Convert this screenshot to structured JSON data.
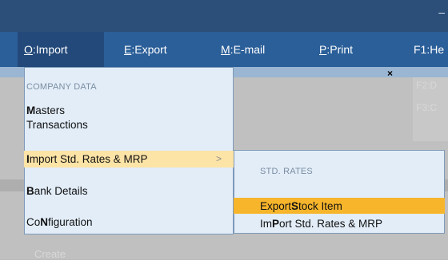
{
  "titlebar": {
    "dash": "–"
  },
  "menubar": {
    "import": {
      "key": "O",
      "sep": ":",
      "label": "Import"
    },
    "export": {
      "key": "E",
      "sep": ":",
      "label": "Export"
    },
    "email": {
      "key": "M",
      "sep": ":",
      "label": "E-mail"
    },
    "print": {
      "key": "P",
      "sep": ":",
      "label": "Print"
    },
    "help": {
      "key": "F1",
      "sep": ":",
      "label": "He"
    }
  },
  "background": {
    "right_items": [
      "F2:D",
      "F3:C"
    ],
    "create": "Create"
  },
  "close_icon": "×",
  "dropdown": {
    "section": "COMPANY DATA",
    "items": {
      "masters": {
        "bold": "M",
        "rest": "asters"
      },
      "transactions": {
        "text": "Transactions"
      },
      "import": {
        "bold": "I",
        "rest": "mport Std. Rates & MRP",
        "arrow": ">"
      },
      "bank": {
        "bold": "B",
        "rest": "ank Details"
      },
      "config": {
        "pre": "Co",
        "bold": "N",
        "rest": "figuration"
      }
    }
  },
  "submenu": {
    "section": "STD. RATES",
    "items": {
      "export": {
        "pre": "Export ",
        "bold": "S",
        "rest": "tock Item"
      },
      "import": {
        "pre": "Im",
        "bold": "P",
        "rest": "ort Std. Rates & MRP"
      }
    }
  },
  "colors": {
    "menubar": "#2b5f99",
    "highlight": "#fce3a6",
    "selected": "#f7b52b",
    "menu_bg": "#e2edf8"
  }
}
